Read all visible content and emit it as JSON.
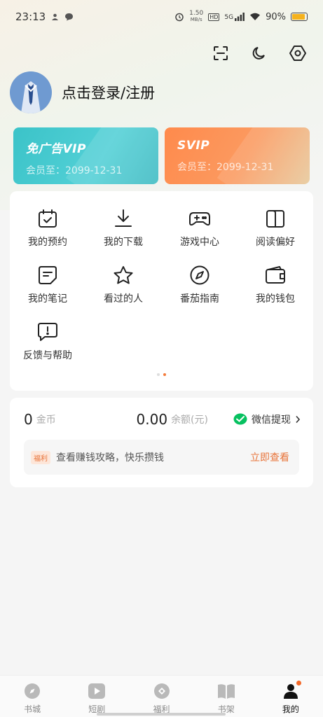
{
  "status_bar": {
    "time": "23:13",
    "speed_value": "1.50",
    "speed_unit": "MB/s",
    "hd": "HD",
    "network": "5G",
    "battery": "90%",
    "battery_level": 0.9
  },
  "header": {
    "login_text": "点击登录/注册"
  },
  "vip_cards": [
    {
      "title": "免广告VIP",
      "expiry": "会员至：2099-12-31"
    },
    {
      "title": "SVIP",
      "expiry": "会员至：2099-12-31"
    }
  ],
  "menu": {
    "items": [
      {
        "label": "我的预约",
        "icon": "calendar-icon"
      },
      {
        "label": "我的下载",
        "icon": "download-icon"
      },
      {
        "label": "游戏中心",
        "icon": "gamepad-icon"
      },
      {
        "label": "阅读偏好",
        "icon": "book-icon"
      },
      {
        "label": "我的笔记",
        "icon": "note-icon"
      },
      {
        "label": "看过的人",
        "icon": "star-icon"
      },
      {
        "label": "番茄指南",
        "icon": "compass-icon"
      },
      {
        "label": "我的钱包",
        "icon": "wallet-icon"
      },
      {
        "label": "反馈与帮助",
        "icon": "feedback-icon"
      }
    ],
    "page_count": 2,
    "active_page": 1
  },
  "wallet": {
    "coins_value": "0",
    "coins_unit": "金币",
    "balance_value": "0.00",
    "balance_unit": "余额(元)",
    "withdraw_label": "微信提现",
    "welfare_tag": "福利",
    "welfare_text": "查看赚钱攻略，快乐攒钱",
    "welfare_link": "立即查看"
  },
  "tabs": [
    {
      "label": "书城",
      "icon": "compass-circle-icon"
    },
    {
      "label": "短剧",
      "icon": "play-icon"
    },
    {
      "label": "福利",
      "icon": "coin-icon"
    },
    {
      "label": "书架",
      "icon": "book-open-icon"
    },
    {
      "label": "我的",
      "icon": "person-icon",
      "active": true
    }
  ],
  "colors": {
    "accent": "#e8743a",
    "vip": "#3bc3c8",
    "svip": "#ff8a4c",
    "wechat": "#07c160"
  }
}
